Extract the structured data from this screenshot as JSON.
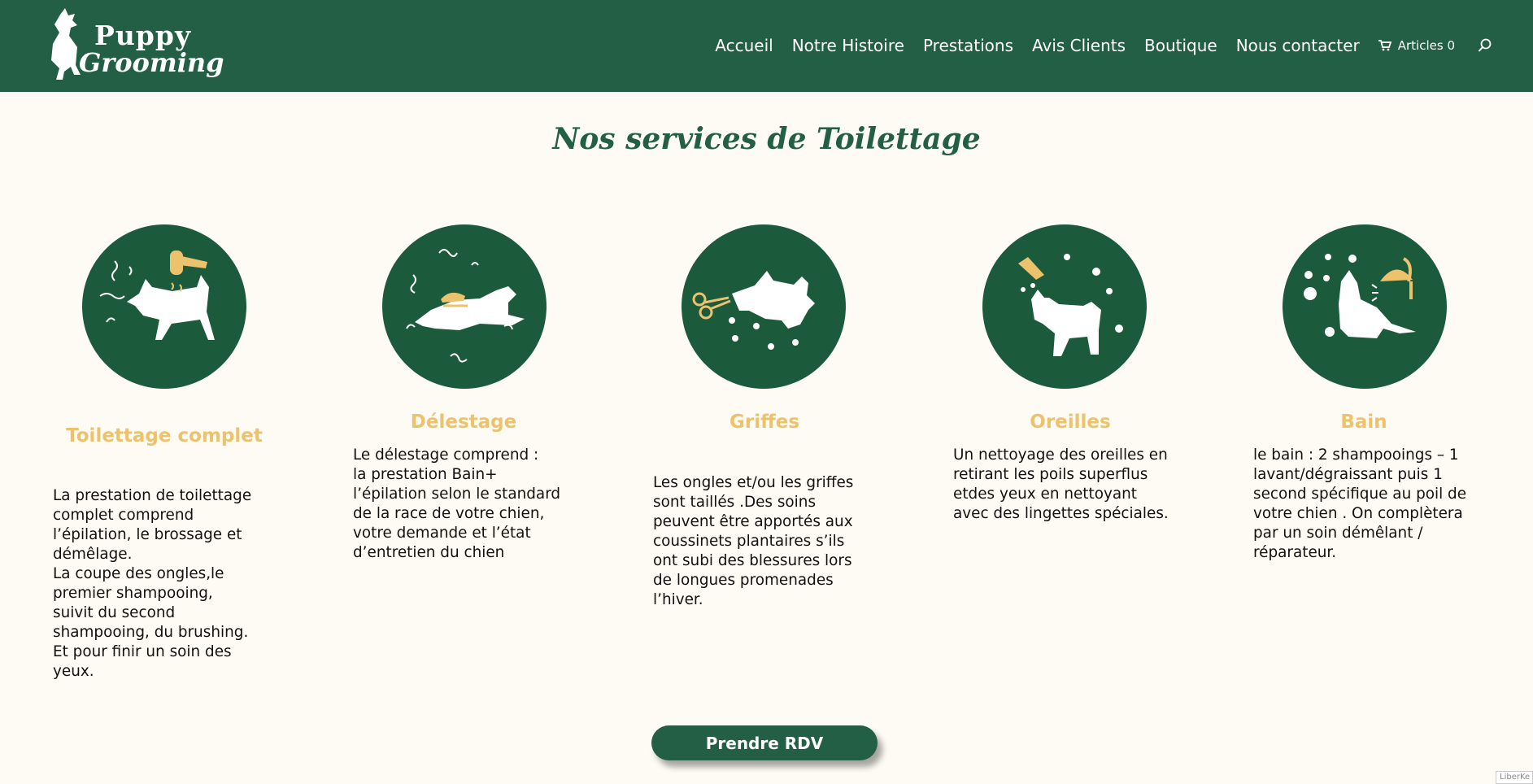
{
  "header": {
    "logo_top": "Puppy",
    "logo_bottom": "Grooming",
    "nav": [
      "Accueil",
      "Notre Histoire",
      "Prestations",
      "Avis Clients",
      "Boutique",
      "Nous contacter"
    ],
    "cart_label": "Articles 0",
    "icons": [
      "cart-icon",
      "search-icon"
    ]
  },
  "section_title": "Nos services de Toilettage",
  "services": [
    {
      "title": "Toilettage complet",
      "icon": "dog-hair-dryer-icon",
      "text": "La prestation de toilettage\ncomplet comprend\nl’épilation, le brossage et\ndémêlage.\nLa coupe des ongles,le\npremier shampooing,\nsuivit du second\nshampooing, du brushing.\nEt pour finir un soin des\nyeux."
    },
    {
      "title": "Délestage",
      "icon": "dog-comb-icon",
      "text": "Le délestage comprend :\nla prestation Bain+\nl’épilation selon le standard\nde la race de votre chien,\nvotre demande et l’état\nd’entretien du chien"
    },
    {
      "title": "Griffes",
      "icon": "dog-scissors-icon",
      "text": "Les ongles et/ou les griffes\nsont taillés .Des soins\npeuvent être apportés aux\ncoussinets plantaires s’ils\nont subi des blessures lors\nde longues promenades\nl’hiver."
    },
    {
      "title": "Oreilles",
      "icon": "dog-ear-drops-icon",
      "text": "Un nettoyage des oreilles en\nretirant les poils superflus\netdes yeux en nettoyant\navec des lingettes spéciales."
    },
    {
      "title": "Bain",
      "icon": "dog-shower-icon",
      "text": "le bain : 2 shampooings – 1\nlavant/dégraissant puis 1\nsecond spécifique au poil de\nvotre chien . On complètera\npar un soin démêlant /\nréparateur."
    }
  ],
  "cta_label": "Prendre RDV",
  "corner_badge": "LiberKe",
  "colors": {
    "header_bg": "#225f45",
    "circle_bg": "#1c5a3c",
    "accent_gold": "#ecc26d",
    "page_bg": "#fdfbf3"
  }
}
